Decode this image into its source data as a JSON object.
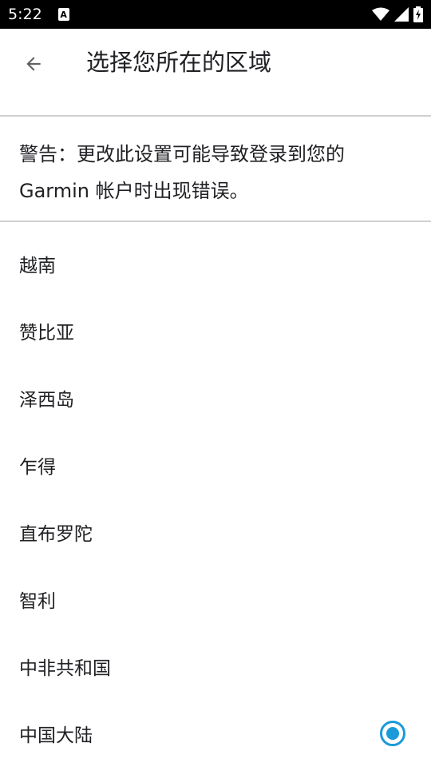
{
  "status_bar": {
    "time": "5:22",
    "notification_icon_label": "A",
    "icons": [
      "wifi-icon",
      "cell-signal-icon",
      "battery-charging-icon"
    ]
  },
  "header": {
    "title": "选择您所在的区域",
    "back_icon": "arrow-left-icon"
  },
  "warning": {
    "text": "警告：更改此设置可能导致登录到您的 Garmin 帐户时出现错误。"
  },
  "regions": [
    {
      "label": "越南",
      "selected": false
    },
    {
      "label": "赞比亚",
      "selected": false
    },
    {
      "label": "泽西岛",
      "selected": false
    },
    {
      "label": "乍得",
      "selected": false
    },
    {
      "label": "直布罗陀",
      "selected": false
    },
    {
      "label": "智利",
      "selected": false
    },
    {
      "label": "中非共和国",
      "selected": false
    },
    {
      "label": "中国大陆",
      "selected": true
    }
  ],
  "colors": {
    "accent": "#1a9ad8",
    "divider": "#d0d0d0",
    "text": "#202124"
  }
}
